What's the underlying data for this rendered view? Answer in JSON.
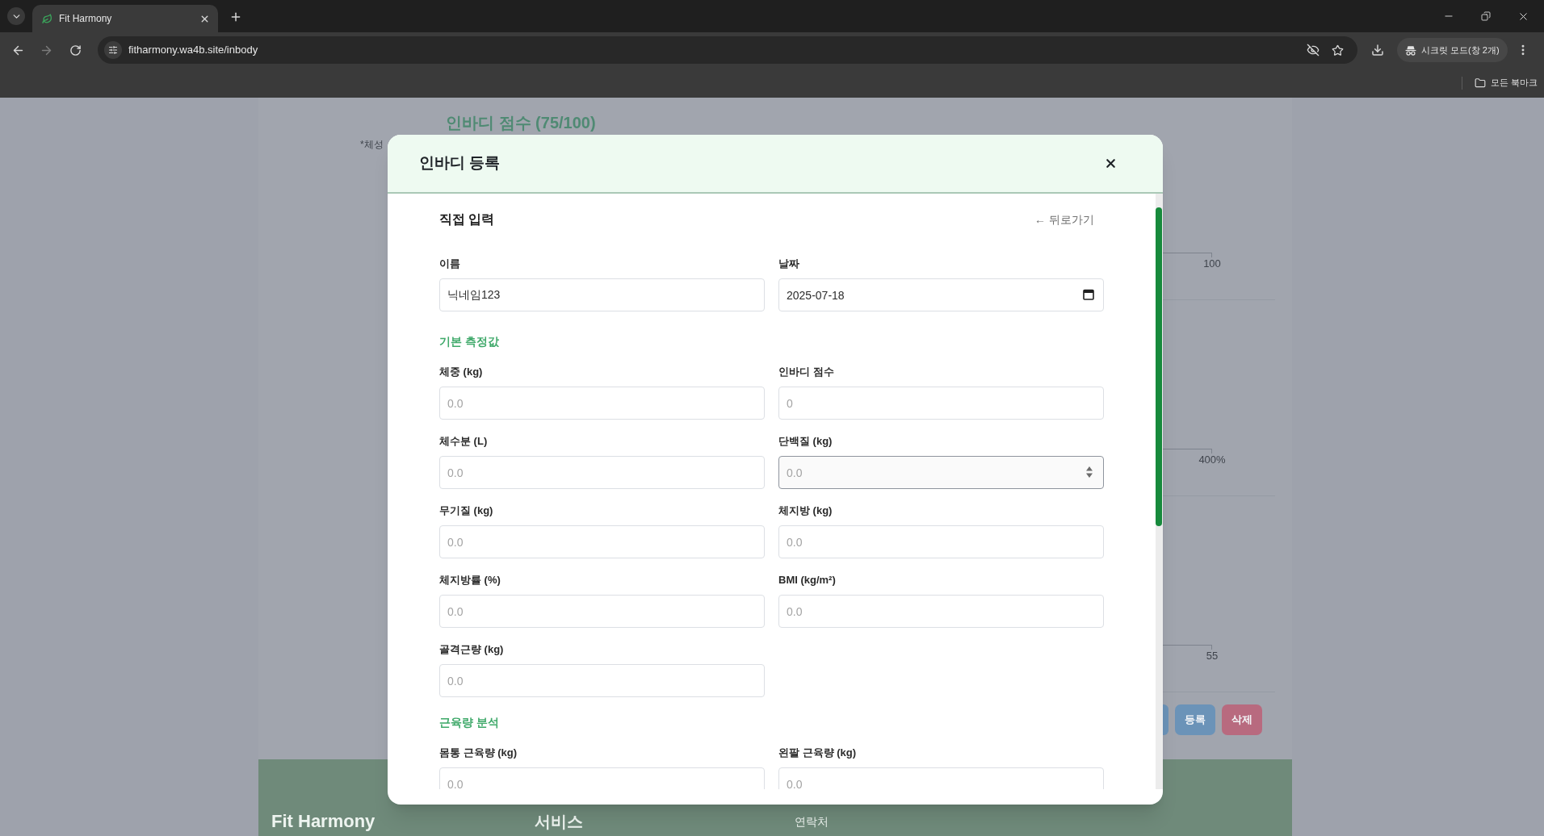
{
  "browser": {
    "tab": {
      "title": "Fit Harmony",
      "selected": true
    },
    "address": "fitharmony.wa4b.site/inbody",
    "profile": "시크릿 모드(창 2개)",
    "bookmarks_folder": "모든 북마크"
  },
  "page": {
    "heading": "인바디 점수 (75/100)",
    "note": "*체성",
    "tick_labels": [
      "100",
      "400%",
      "55"
    ],
    "buttons": [
      {
        "label": "등록",
        "color": "#6b93b8"
      },
      {
        "label": "삭제",
        "color": "#b86a7f"
      }
    ],
    "footer": [
      {
        "text": "Fit Harmony",
        "kind": "brand"
      },
      {
        "text": "서비스",
        "kind": "heading"
      },
      {
        "text": "연락처",
        "kind": "label"
      }
    ]
  },
  "modal": {
    "title": "인바디 등록",
    "subtitle": "직접 입력",
    "back_link": "← 뒤로가기",
    "top_fields": [
      {
        "label": "이름",
        "kind": "text",
        "value": "닉네임123"
      },
      {
        "label": "날짜",
        "kind": "date",
        "value": "2025-07-18"
      }
    ],
    "sections": [
      {
        "title": "기본 측정값",
        "fields": [
          {
            "label": "체중 (kg)",
            "kind": "number",
            "placeholder": "0.0",
            "hovered": false
          },
          {
            "label": "인바디 점수",
            "kind": "number",
            "placeholder": "0",
            "hovered": false
          },
          {
            "label": "체수분 (L)",
            "kind": "number",
            "placeholder": "0.0",
            "hovered": false
          },
          {
            "label": "단백질 (kg)",
            "kind": "number",
            "placeholder": "0.0",
            "hovered": true
          },
          {
            "label": "무기질 (kg)",
            "kind": "number",
            "placeholder": "0.0",
            "hovered": false
          },
          {
            "label": "체지방 (kg)",
            "kind": "number",
            "placeholder": "0.0",
            "hovered": false
          },
          {
            "label": "체지방률 (%)",
            "kind": "number",
            "placeholder": "0.0",
            "hovered": false
          },
          {
            "label": "BMI (kg/m²)",
            "kind": "number",
            "placeholder": "0.0",
            "hovered": false
          },
          {
            "label": "골격근량 (kg)",
            "kind": "number",
            "placeholder": "0.0",
            "hovered": false
          }
        ]
      },
      {
        "title": "근육량 분석",
        "fields": [
          {
            "label": "몸통 근육량 (kg)",
            "kind": "number",
            "placeholder": "0.0",
            "hovered": false
          },
          {
            "label": "왼팔 근육량 (kg)",
            "kind": "number",
            "placeholder": "0.0",
            "hovered": false
          }
        ]
      }
    ]
  }
}
